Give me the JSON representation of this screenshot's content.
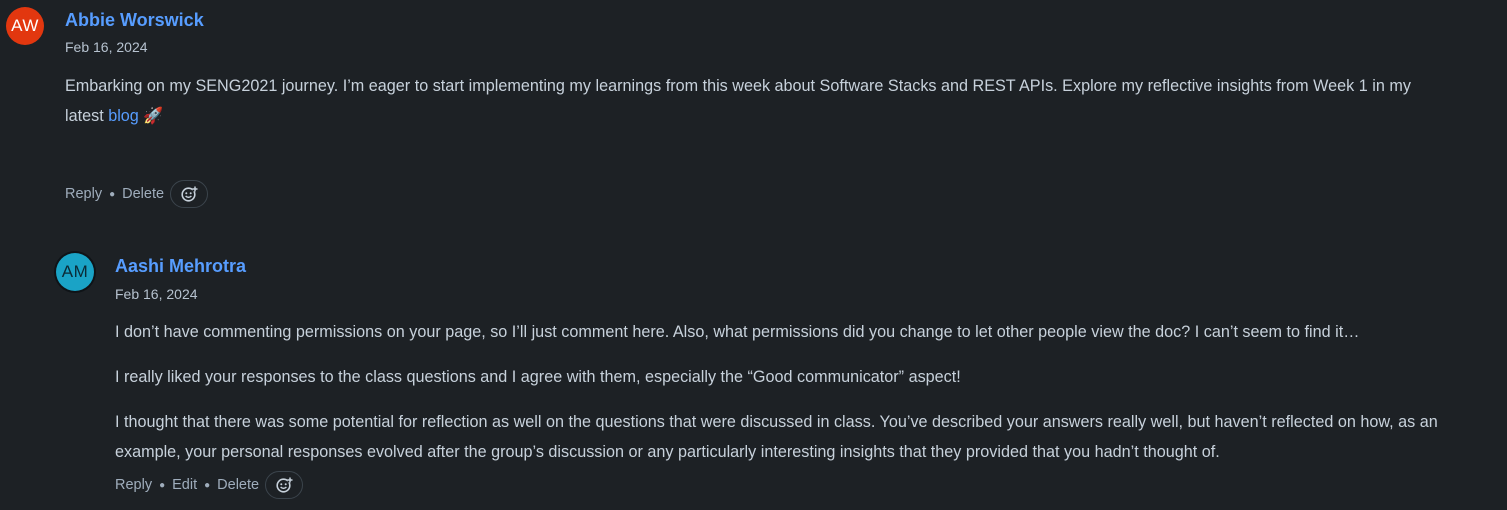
{
  "comments": [
    {
      "initials": "AW",
      "author": "Abbie Worswick",
      "date": "Feb 16, 2024",
      "body_line1": "Embarking on my SENG2021 journey. I’m eager to start implementing my learnings from this week about Software Stacks and REST APIs. Explore my reflective insights from Week 1 in my",
      "body_line2_prefix": "latest ",
      "link_text": "blog",
      "emoji": "🚀",
      "actions": {
        "reply": "Reply",
        "delete": "Delete"
      },
      "reaction_icon": "add-reaction-icon"
    },
    {
      "initials": "AM",
      "author": "Aashi Mehrotra",
      "date": "Feb 16, 2024",
      "paragraphs": [
        "I don’t have commenting permissions on your page, so I’ll just comment here. Also, what permissions did you change to let other people view the doc? I can’t seem to find it…",
        "I really liked your responses to the class questions and I agree with them, especially the “Good communicator” aspect!",
        "I thought that there was some potential for reflection as well on the questions that were discussed in class. You’ve described your answers really well, but haven’t reflected on how, as an example, your personal responses evolved after the group’s discussion or any particularly interesting insights that they provided that you hadn’t thought of."
      ],
      "actions": {
        "reply": "Reply",
        "edit": "Edit",
        "delete": "Delete"
      },
      "reaction_icon": "add-reaction-icon"
    }
  ],
  "colors": {
    "background": "#1d2125",
    "author": "#579dff",
    "text": "#c7d1db",
    "avatar_aw": "#e2370f",
    "avatar_am": "#1aa3c6"
  }
}
